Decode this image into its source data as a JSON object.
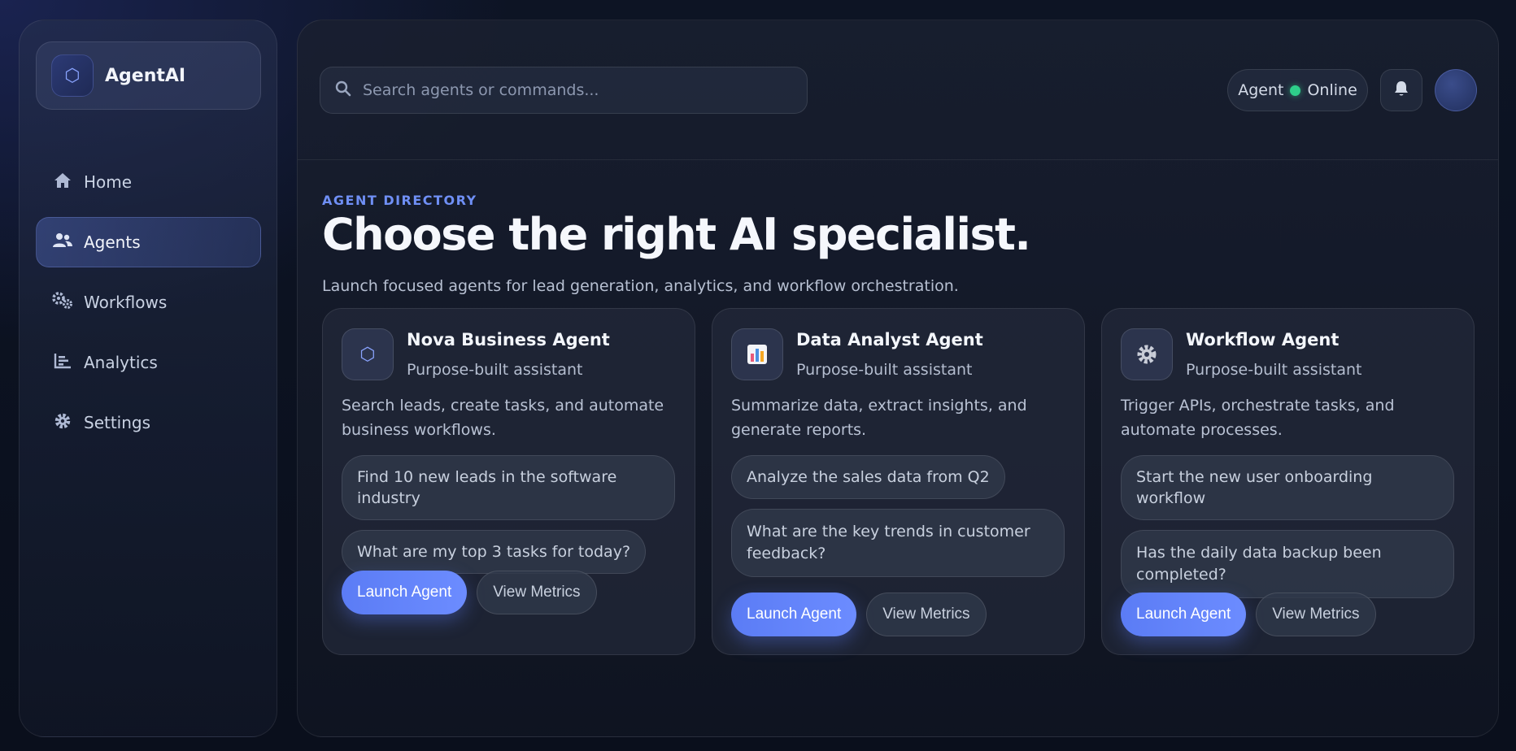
{
  "brand": {
    "name": "AgentAI",
    "logo_icon": "hexagon-icon"
  },
  "sidebar": {
    "items": [
      {
        "label": "Home",
        "icon": "home-icon",
        "active": false
      },
      {
        "label": "Agents",
        "icon": "users-icon",
        "active": true
      },
      {
        "label": "Workflows",
        "icon": "gears-icon",
        "active": false
      },
      {
        "label": "Analytics",
        "icon": "chart-icon",
        "active": false
      },
      {
        "label": "Settings",
        "icon": "gear-icon",
        "active": false
      }
    ]
  },
  "header": {
    "search_placeholder": "Search agents or commands...",
    "status_label": "Agent",
    "status_value": "Online",
    "status_color": "#2ecf8a"
  },
  "hero": {
    "eyebrow": "AGENT DIRECTORY",
    "title": "Choose the right AI specialist.",
    "subtitle": "Launch focused agents for lead generation, analytics, and workflow orchestration."
  },
  "cards": [
    {
      "icon": "hexagon-icon",
      "title": "Nova Business Agent",
      "tag": "Purpose-built assistant",
      "description": "Search leads, create tasks, and automate business workflows.",
      "prompts": [
        "Find 10 new leads in the software industry",
        "What are my top 3 tasks for today?"
      ],
      "launch_label": "Launch Agent",
      "metrics_label": "View Metrics"
    },
    {
      "icon": "bar-chart-icon",
      "title": "Data Analyst Agent",
      "tag": "Purpose-built assistant",
      "description": "Summarize data, extract insights, and generate reports.",
      "prompts": [
        "Analyze the sales data from Q2",
        "What are the key trends in customer feedback?"
      ],
      "launch_label": "Launch Agent",
      "metrics_label": "View Metrics"
    },
    {
      "icon": "gear-icon",
      "title": "Workflow Agent",
      "tag": "Purpose-built assistant",
      "description": "Trigger APIs, orchestrate tasks, and automate processes.",
      "prompts": [
        "Start the new user onboarding workflow",
        "Has the daily data backup been completed?"
      ],
      "launch_label": "Launch Agent",
      "metrics_label": "View Metrics"
    }
  ],
  "colors": {
    "accent": "#5b7cf5",
    "eyebrow": "#6f8ff5"
  }
}
